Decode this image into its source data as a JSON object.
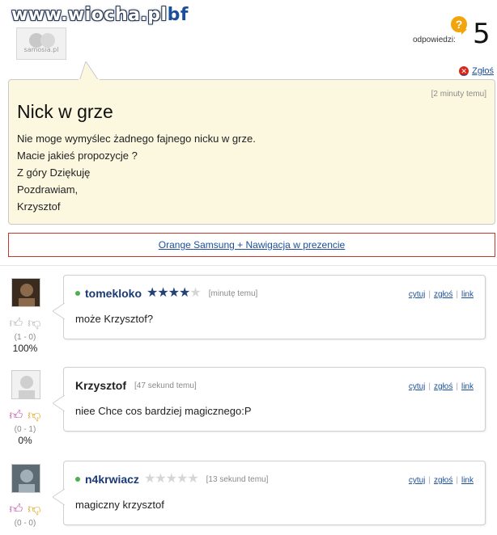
{
  "watermark": {
    "main": "www.wiocha.pl",
    "suffix": "bf"
  },
  "asker": {
    "avatar_text": "samosia.pl"
  },
  "header": {
    "answers_label": "odpowiedzi:",
    "answers_count": "5",
    "report_label": "Zgłoś"
  },
  "question": {
    "time": "[2 minuty temu]",
    "title": "Nick w grze",
    "body_lines": [
      "Nie moge wymyślec żadnego fajnego nicku w grze.",
      "Macie jakieś propozycje ?",
      "Z góry Dziękuję",
      "Pozdrawiam,",
      "Krzysztof"
    ]
  },
  "promo": {
    "label": "Orange Samsung + Nawigacja w prezencie"
  },
  "actions": {
    "quote": "cytuj",
    "report": "zgłoś",
    "link": "link"
  },
  "answers": [
    {
      "nick": "tomekloko",
      "online": true,
      "stars": 3.5,
      "time": "[minutę temu]",
      "text": "może Krzysztof?",
      "votes": "(1 - 0)",
      "percent": "100%",
      "up_active": false,
      "down_active": false
    },
    {
      "nick": "Krzysztof",
      "online": false,
      "stars": null,
      "time": "[47 sekund temu]",
      "text": "niee Chce cos bardziej magicznego:P",
      "votes": "(0 - 1)",
      "percent": "0%",
      "up_active": true,
      "down_active": true
    },
    {
      "nick": "n4krwiacz",
      "online": true,
      "stars": 0,
      "time": "[13 sekund temu]",
      "text": "magiczny krzysztof",
      "votes": "(0 - 0)",
      "percent": "",
      "up_active": true,
      "down_active": true
    }
  ],
  "colors": {
    "question_bg": "#fcf8e0",
    "link": "#1b4f9c",
    "promo_border": "#c0392b",
    "badge": "#f2a40c",
    "report_icon": "#d7281d"
  },
  "icons": {
    "report": "x-circle-icon",
    "answers": "question-bubble-icon",
    "vote_up": "thumb-up-icon",
    "vote_down": "thumb-down-icon",
    "rating": "star-icon"
  }
}
